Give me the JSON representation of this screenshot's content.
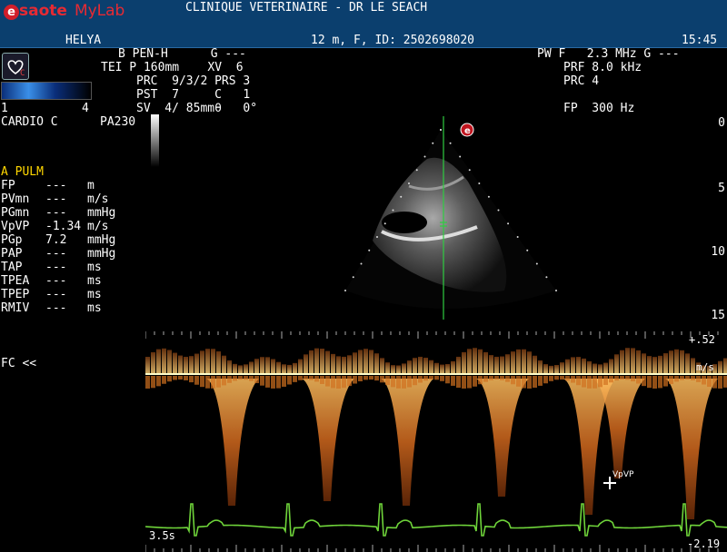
{
  "header": {
    "brand_letter": "e",
    "brand_name": "saote",
    "brand_product": "MyLab",
    "clinic": "CLINIQUE VETERINAIRE - DR LE SEACH",
    "patient_name": "HELYA",
    "patient_info": "12 m, F, ID: 2502698020",
    "time": "15:45"
  },
  "left_panel": {
    "heart_badge": "C",
    "probe_num_left": "1",
    "probe_num_right": "4",
    "preset": "CARDIO C",
    "probe": "PA230"
  },
  "acq_params": {
    "line1": "B PEN-H      G ---",
    "line2": "TEI P 160mm    XV  6",
    "line3": "PRC  9/3/2 PRS 3",
    "line4": "PST  7     C   1",
    "line5": "SV  4/ 85mmθ   0°"
  },
  "pw_params": {
    "line1": "PW F   2.3 MHz G ---",
    "line2": "PRF 8.0 kHz",
    "line3": "PRC 4",
    "line4": "FP  300 Hz"
  },
  "measurements": {
    "title": "A PULM",
    "rows": [
      {
        "label": "FP",
        "value": "---",
        "unit": "m"
      },
      {
        "label": "PVmn",
        "value": "---",
        "unit": "m/s"
      },
      {
        "label": "PGmn",
        "value": "---",
        "unit": "mmHg"
      },
      {
        "label": "VpVP",
        "value": "-1.34",
        "unit": "m/s"
      },
      {
        "label": "PGp",
        "value": "7.2",
        "unit": "mmHg"
      },
      {
        "label": "PAP",
        "value": "---",
        "unit": "mmHg"
      },
      {
        "label": "TAP",
        "value": "---",
        "unit": "ms"
      },
      {
        "label": "TPEA",
        "value": "---",
        "unit": "ms"
      },
      {
        "label": "TPEP",
        "value": "---",
        "unit": "ms"
      },
      {
        "label": "RMIV",
        "value": "---",
        "unit": "ms"
      }
    ]
  },
  "depth_scale": [
    "0",
    "5",
    "10",
    "15"
  ],
  "doppler": {
    "fc_label": "FC <<",
    "scale_top": "+.52",
    "unit": "m/s",
    "scale_bottom": "-2.19",
    "sweep": "3.5s",
    "cursor_label": "VpVP"
  },
  "colors": {
    "header_bg": "#0b3f6e",
    "measurement_title": "#ffd700",
    "doppler_signal": "#ff8a1e",
    "ecg_trace": "#6fd43a",
    "baseline": "#ffffcc"
  }
}
